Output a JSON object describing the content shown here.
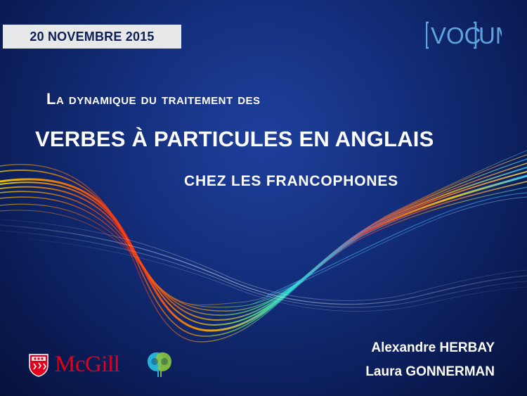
{
  "date": "20 NOVEMBRE 2015",
  "logo": {
    "name": "VOCUM",
    "color": "#5fa3e0"
  },
  "title": {
    "line1": "La dynamique du traitement des",
    "line2": "VERBES À PARTICULES EN ANGLAIS",
    "line3": "CHEZ LES FRANCOPHONES"
  },
  "authors": [
    "Alexandre HERBAY",
    "Laura GONNERMAN"
  ],
  "institution": {
    "name": "McGill",
    "color": "#e3001b",
    "crest_icon": "mcgill-crest-icon"
  },
  "lab_icon": "two-heads-icon",
  "colors": {
    "background": "#14307f",
    "date_box": "#e7e8ea",
    "text": "#ffffff"
  }
}
